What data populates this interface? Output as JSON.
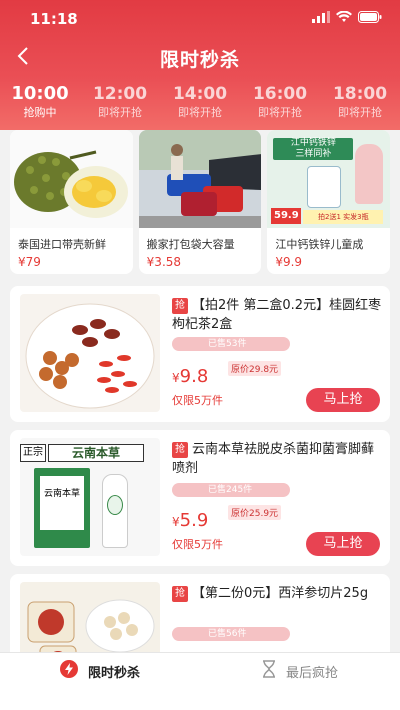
{
  "status": {
    "time": "11:18"
  },
  "header": {
    "title": "限时秒杀"
  },
  "tabs": [
    {
      "time": "10:00",
      "status": "抢购中"
    },
    {
      "time": "12:00",
      "status": "即将开抢"
    },
    {
      "time": "14:00",
      "status": "即将开抢"
    },
    {
      "time": "16:00",
      "status": "即将开抢"
    },
    {
      "time": "18:00",
      "status": "即将开抢"
    }
  ],
  "featured": [
    {
      "name": "泰国进口带壳新鲜",
      "price": "¥79"
    },
    {
      "name": "搬家打包袋大容量",
      "price": "¥3.58"
    },
    {
      "name": "江中钙铁锌儿童成",
      "price": "¥9.9",
      "img_text": {
        "brand": "江中钙铁锌",
        "slogan": "三样同补",
        "price_tag": "59.9",
        "promo": "拍2送1 实发3瓶"
      }
    }
  ],
  "products": [
    {
      "tag": "抢",
      "title": "【拍2件 第二盒0.2元】桂圆红枣枸杞茶2盒",
      "sold": "已售53件",
      "price_symbol": "¥",
      "price": "9.8",
      "original": "原价29.8元",
      "limit": "仅限5万件",
      "button": "马上抢"
    },
    {
      "tag": "抢",
      "title": "云南本草祛脱皮杀菌抑菌膏脚藓喷剂",
      "sold": "已售245件",
      "price_symbol": "¥",
      "price": "5.9",
      "original": "原价25.9元",
      "limit": "仅限5万件",
      "button": "马上抢",
      "img_text": {
        "left": "正宗",
        "brand": "云南本草",
        "box": "云南本草"
      }
    },
    {
      "tag": "抢",
      "title": "【第二份0元】西洋参切片25g",
      "sold": "已售56件"
    }
  ],
  "tabbar": {
    "active": "限时秒杀",
    "inactive": "最后疯抢"
  }
}
